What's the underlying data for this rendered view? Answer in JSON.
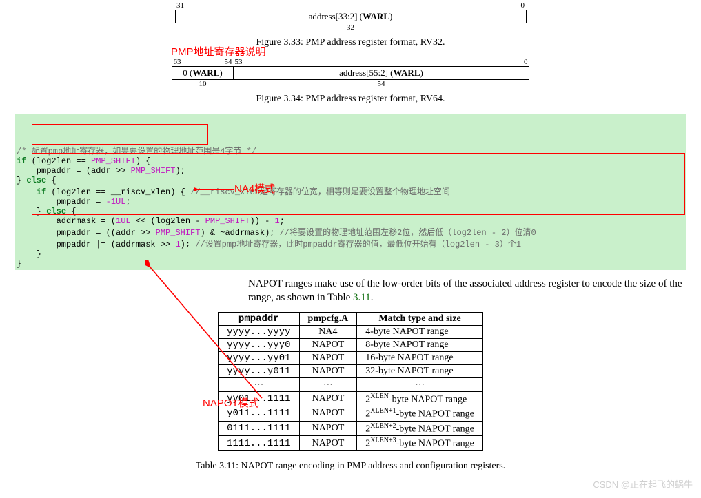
{
  "annotations": {
    "pmp_addr_desc": "PMP地址寄存器说明",
    "na4_mode": "NA4模式",
    "napot_mode": "NAPOT模式"
  },
  "fig33": {
    "bit_hi": "31",
    "bit_lo": "0",
    "field": "address[33:2] (WARL)",
    "width": "32",
    "caption": "Figure 3.33: PMP address register format, RV32."
  },
  "fig34": {
    "bit63": "63",
    "bit54": "54",
    "bit53": "53",
    "bit0": "0",
    "field0": "0 (WARL)",
    "field1": "address[55:2] (WARL)",
    "w0": "10",
    "w1": "54",
    "caption": "Figure 3.34: PMP address register format, RV64."
  },
  "code": {
    "c0": "/* 配置pmp地址寄存器，如果要设置的物理地址范围是4字节 */",
    "c1a": "if",
    "c1b": " (log2len == ",
    "c1c": "PMP_SHIFT",
    "c1d": ") {",
    "c2a": "    pmpaddr = (addr >> ",
    "c2b": "PMP_SHIFT",
    "c2c": ");",
    "c3a": "} ",
    "c3b": "else",
    "c3c": " {",
    "c4a": "    ",
    "c4b": "if",
    "c4c": " (log2len == __riscv_xlen) { ",
    "c4d": "//__riscv_xlen是寄存器的位宽，相等则是要设置整个物理地址空间",
    "c5a": "        pmpaddr = ",
    "c5b": "-1UL",
    "c5c": ";",
    "c6a": "    } ",
    "c6b": "else",
    "c6c": " {",
    "c7a": "        addrmask = (",
    "c7b": "1UL",
    "c7c": " << (log2len - ",
    "c7d": "PMP_SHIFT",
    "c7e": ")) - ",
    "c7f": "1",
    "c7g": ";",
    "c8a": "        pmpaddr = ((addr >> ",
    "c8b": "PMP_SHIFT",
    "c8c": ") & ~addrmask); ",
    "c8d": "//将要设置的物理地址范围左移2位，然后低（log2len - 2）位清0",
    "c9a": "        pmpaddr |= (addrmask >> ",
    "c9b": "1",
    "c9c": "); ",
    "c9d": "//设置pmp地址寄存器，此时pmpaddr寄存器的值，最低位开始有（log2len - 3）个1",
    "c10": "    }",
    "c11": "}"
  },
  "napot_para1": "NAPOT ranges make use of the low-order bits of the associated address register to encode the size of the range, as shown in Table ",
  "napot_link": "3.11",
  "napot_para2": ".",
  "table311": {
    "h0": "pmpaddr",
    "h1": "pmpcfg.A",
    "h2": "Match type and size",
    "rows": [
      {
        "a": "yyyy...yyyy",
        "b": "NA4",
        "c": "4-byte NAPOT range"
      },
      {
        "a": "yyyy...yyy0",
        "b": "NAPOT",
        "c": "8-byte NAPOT range"
      },
      {
        "a": "yyyy...yy01",
        "b": "NAPOT",
        "c": "16-byte NAPOT range"
      },
      {
        "a": "yyyy...y011",
        "b": "NAPOT",
        "c": "32-byte NAPOT range"
      },
      {
        "a": "⋯",
        "b": "⋯",
        "c": "⋯"
      },
      {
        "a": "yy01...1111",
        "b": "NAPOT",
        "c": "2^XLEN-byte NAPOT range",
        "sup": "XLEN",
        "suffix": "-byte NAPOT range"
      },
      {
        "a": "y011...1111",
        "b": "NAPOT",
        "c": "2^(XLEN+1)-byte NAPOT range",
        "sup": "XLEN+1",
        "suffix": "-byte NAPOT range"
      },
      {
        "a": "0111...1111",
        "b": "NAPOT",
        "c": "2^(XLEN+2)-byte NAPOT range",
        "sup": "XLEN+2",
        "suffix": "-byte NAPOT range"
      },
      {
        "a": "1111...1111",
        "b": "NAPOT",
        "c": "2^(XLEN+3)-byte NAPOT range",
        "sup": "XLEN+3",
        "suffix": "-byte NAPOT range"
      }
    ],
    "caption": "Table 3.11: NAPOT range encoding in PMP address and configuration registers."
  },
  "watermark": "CSDN @正在起飞的蜗牛"
}
